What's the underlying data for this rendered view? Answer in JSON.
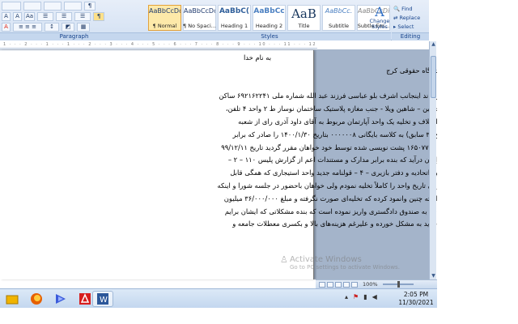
{
  "ribbon": {
    "font_row": {
      "grow_label": "A",
      "shrink_label": "A",
      "clear_label": "Aa"
    },
    "paragraph_label": "Paragraph",
    "styles_label": "Styles",
    "editing_label": "Editing",
    "styles": [
      {
        "preview": "AaBbCcDc",
        "name": "¶ Normal",
        "selected": true
      },
      {
        "preview": "AaBbCcDc",
        "name": "¶ No Spaci..."
      },
      {
        "preview": "AaBbC(",
        "name": "Heading 1"
      },
      {
        "preview": "AaBbCc",
        "name": "Heading 2"
      },
      {
        "preview": "AaB",
        "name": "Title"
      },
      {
        "preview": "AaBbCc.",
        "name": "Subtitle"
      },
      {
        "preview": "AaBbCcDi",
        "name": "Subtle Em..."
      }
    ],
    "change_styles": {
      "icon": "A",
      "label": "Change Styles"
    },
    "editing": {
      "find": "Find",
      "replace": "Replace",
      "select": "Select"
    }
  },
  "ruler_text": "1 · · · 2 · · · 1 · · · 1 · · · 2 · · · 3 · · · 4 · · · 5 · · · 6 · · · 7 · · · 8 · · · 9 · · · 10 · · · 11 · · · 12 · · · 13 · · · 14 · · · 15 · · · 16",
  "document": {
    "lines": [
      "به نام خدا",
      "ریاست محترم شعبه دوم دادگاه حقوقی کرج",
      "سلام علیکم؛",
      "با احترام به استحضار می‌رساند اینجانب اشرف بلو عباسی فرزند عبد الله شماره ملی ۶۹۲۱۶۲۲۴۱ ساکن",
      "آدرس، کرج –میدان امام حسین – شاهین ویلا - جنب مغازه پلاستیک ساختمان نوساز ط ۲ واحد ۴ تلفن،",
      "۰۹۳۸۴۵۵۲۱۹۳ درخصوص اختلاف و تخلیه یک واحد آپارتمان مربوط به آقای داود آذری رای از شعبه",
      "۱۱ شورای حل اختلاف کرج (۳ سابق) به کلاسه بایگانی ۰۰۰۰۰۰۸ بتاریخ ۱۴۰۰/۱/۳۰ را صادر که برابر",
      "قولنامه تنظیمی به شماره ۱۶۵۰۷۷۴۱ پشت نویسی شده توسط خود خواهان مقرر گردید تاریخ ۹۹/۱۲/۱۱",
      "واحد تخلیه و به تصرف خواهان درآید که بنده برابر مدارک و مستندات اعم از گزارش پلیس ۱۱۰ – ۲ –",
      "استشهادیه محلی – ۳ – تائید اتحادیه و دفتر بازیری – ۴ – قولنامه جدید واحد استیجاری که همگی قابل",
      "ارائه و پیوست می‌باشد در آن تاریخ واحد را کاملاً تخلیه نمودم ولی خواهان باحضور در جلسه شورا و اینکه",
      "بنده سواد قضایی کافی نداشته چنین وانمود کرده که تخلیه‌ای صورت نگرفته و مبلغ ۳۶/۰۰۰/۰۰۰ میلیون",
      "تومان از عین ودیعه (رهن) را به صندوق دادگستری واریز نموده است که بنده مشکلاتی که ایشان برایم",
      "بوجود آورده حتی با موجر جدید به مشکل خورده و علیرغم هزینه‌های بالا و بکسری معطلات جامعه و"
    ]
  },
  "watermark": {
    "title": "Activate Windows",
    "subtitle": "Go to PC settings to activate Windows."
  },
  "statusbar": {
    "zoom": "100%"
  },
  "taskbar": {
    "apps": [
      {
        "name": "windows-explorer",
        "color": "#f0b400"
      },
      {
        "name": "firefox",
        "color": "#e66000"
      },
      {
        "name": "media-player",
        "color": "#3b5bdb"
      },
      {
        "name": "acrobat",
        "color": "#d71e1e"
      },
      {
        "name": "word",
        "color": "#2b579a"
      }
    ],
    "time": "2:05 PM",
    "date": "11/30/2021"
  }
}
